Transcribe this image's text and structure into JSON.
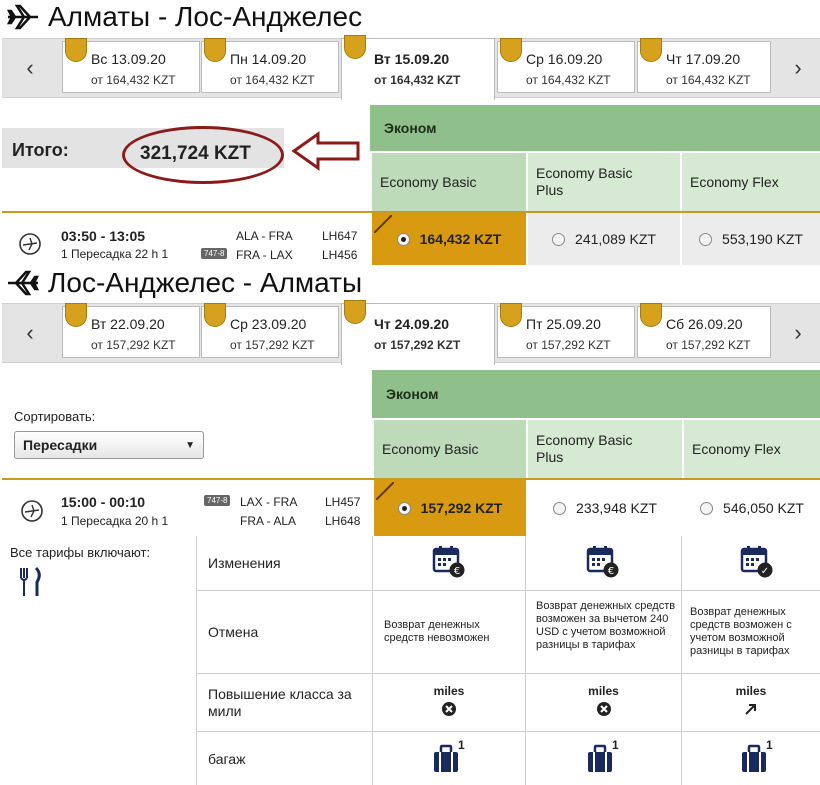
{
  "outbound": {
    "title": "Алматы - Лос-Анджелес",
    "dates": [
      {
        "day": "Вс 13.09.20",
        "price": "от  164,432 KZT"
      },
      {
        "day": "Пн 14.09.20",
        "price": "от  164,432 KZT"
      },
      {
        "day": "Вт 15.09.20",
        "price": "от  164,432 KZT"
      },
      {
        "day": "Ср 16.09.20",
        "price": "от  164,432 KZT"
      },
      {
        "day": "Чт 17.09.20",
        "price": "от  164,432 KZT"
      }
    ],
    "total_label": "Итого:",
    "total_value": "321,724 KZT",
    "cabin": "Эконом",
    "fares": [
      "Economy Basic",
      "Economy Basic Plus",
      "Economy Flex"
    ],
    "flight": {
      "time": "03:50 - 13:05",
      "stops": "1 Пересадка 22 h 1",
      "aircraft": "747-8",
      "segments": [
        "ALA - FRA",
        "FRA - LAX"
      ],
      "flight_numbers": [
        "LH647",
        "LH456"
      ],
      "prices": [
        "164,432 KZT",
        "241,089 KZT",
        "553,190 KZT"
      ]
    }
  },
  "inbound": {
    "title": "Лос-Анджелес - Алматы",
    "dates": [
      {
        "day": "Вт 22.09.20",
        "price": "от  157,292 KZT"
      },
      {
        "day": "Ср 23.09.20",
        "price": "от  157,292 KZT"
      },
      {
        "day": "Чт 24.09.20",
        "price": "от  157,292 KZT"
      },
      {
        "day": "Пт 25.09.20",
        "price": "от  157,292 KZT"
      },
      {
        "day": "Сб 26.09.20",
        "price": "от  157,292 KZT"
      }
    ],
    "sort_label": "Сортировать:",
    "sort_value": "Пересадки",
    "cabin": "Эконом",
    "fares": [
      "Economy Basic",
      "Economy Basic Plus",
      "Economy Flex"
    ],
    "flight": {
      "time": "15:00 - 00:10",
      "stops": "1 Пересадка 20 h 1",
      "aircraft": "747-8",
      "segments": [
        "LAX - FRA",
        "FRA - ALA"
      ],
      "flight_numbers": [
        "LH457",
        "LH648"
      ],
      "prices": [
        "157,292 KZT",
        "233,948 KZT",
        "546,050 KZT"
      ]
    }
  },
  "included": {
    "label": "Все тарифы включают:",
    "rows": [
      {
        "label": "Изменения"
      },
      {
        "label": "Отмена",
        "cells": [
          "Возврат денежных средств невозможен",
          "Возврат денежных средств возможен за вычетом 240 USD с учетом возможной разницы в тарифах",
          "Возврат денежных средств возможен с учетом возможной разницы в тарифах"
        ]
      },
      {
        "label": "Повышение класса за мили",
        "miles": "miles"
      },
      {
        "label": "багаж",
        "bag_count": "1"
      }
    ]
  },
  "colors": {
    "accent": "#d79a10",
    "green": "#8fbf8a",
    "light_green": "#d6e9d3",
    "red_outline": "#8b1a1a"
  }
}
